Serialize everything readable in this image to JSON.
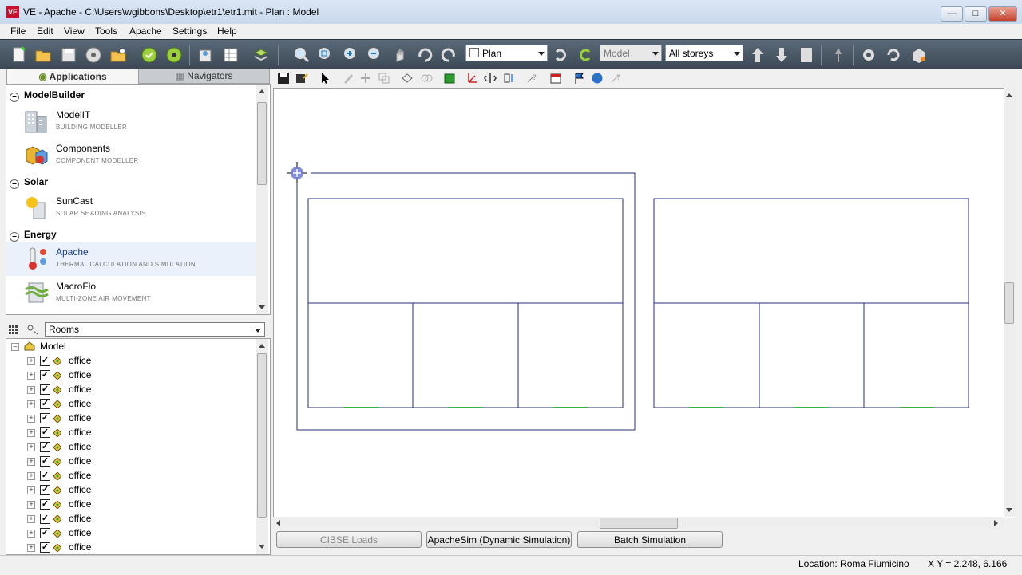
{
  "window": {
    "app_icon": "VE",
    "title": "VE - Apache - C:\\Users\\wgibbons\\Desktop\\etr1\\etr1.mit - Plan : Model",
    "controls": [
      "minimize-icon",
      "maximize-icon",
      "close-icon"
    ]
  },
  "menu": [
    "File",
    "Edit",
    "View",
    "Tools",
    "Apache",
    "Settings",
    "Help"
  ],
  "toolbar": {
    "view_select": "Plan",
    "mode_select": "Model",
    "storey_select": "All storeys"
  },
  "left_tabs": {
    "applications": "Applications",
    "navigators": "Navigators"
  },
  "applications": {
    "groups": [
      {
        "name": "ModelBuilder",
        "apps": [
          {
            "name": "ModelIT",
            "subtitle": "BUILDING MODELLER"
          },
          {
            "name": "Components",
            "subtitle": "COMPONENT MODELLER"
          }
        ]
      },
      {
        "name": "Solar",
        "apps": [
          {
            "name": "SunCast",
            "subtitle": "SOLAR SHADING ANALYSIS"
          }
        ]
      },
      {
        "name": "Energy",
        "apps": [
          {
            "name": "Apache",
            "subtitle": "THERMAL CALCULATION AND SIMULATION"
          },
          {
            "name": "MacroFlo",
            "subtitle": "MULTI-ZONE AIR MOVEMENT"
          }
        ]
      }
    ]
  },
  "navigator": {
    "filter_select": "Rooms",
    "root": "Model",
    "items": [
      "office",
      "office",
      "office",
      "office",
      "office",
      "office",
      "office",
      "office",
      "office",
      "office",
      "office",
      "office",
      "office",
      "office"
    ]
  },
  "bottom_buttons": {
    "cibse": "CIBSE Loads",
    "apachesim": "ApacheSim (Dynamic Simulation)",
    "batch": "Batch Simulation"
  },
  "status": {
    "location": "Location: Roma Fiumicino",
    "xy": "X Y =  2.248,  6.166"
  },
  "colors": {
    "plan_lines": "#2a2f7a",
    "window_marks": "#3cb043",
    "toolbar_bg": "#4b5866"
  }
}
